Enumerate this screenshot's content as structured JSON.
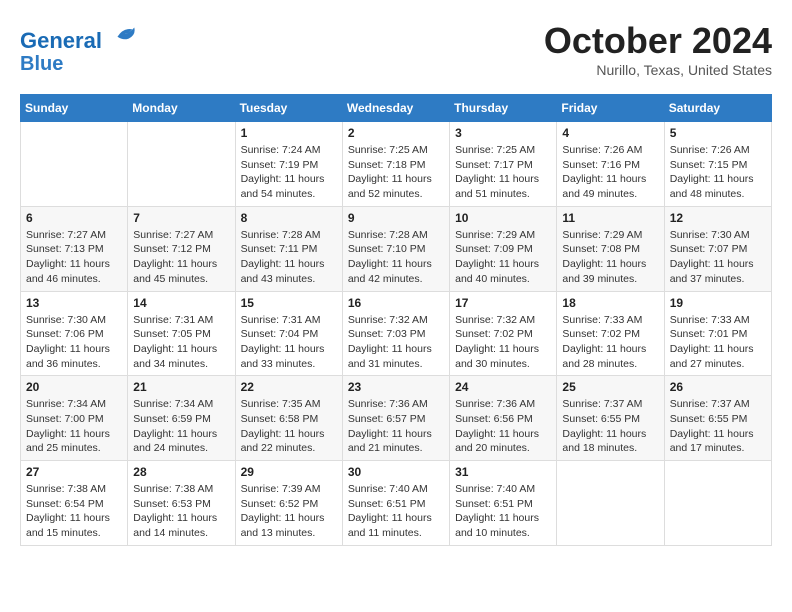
{
  "header": {
    "logo_line1": "General",
    "logo_line2": "Blue",
    "month": "October 2024",
    "location": "Nurillo, Texas, United States"
  },
  "weekdays": [
    "Sunday",
    "Monday",
    "Tuesday",
    "Wednesday",
    "Thursday",
    "Friday",
    "Saturday"
  ],
  "weeks": [
    [
      {
        "day": "",
        "sunrise": "",
        "sunset": "",
        "daylight": ""
      },
      {
        "day": "",
        "sunrise": "",
        "sunset": "",
        "daylight": ""
      },
      {
        "day": "1",
        "sunrise": "Sunrise: 7:24 AM",
        "sunset": "Sunset: 7:19 PM",
        "daylight": "Daylight: 11 hours and 54 minutes."
      },
      {
        "day": "2",
        "sunrise": "Sunrise: 7:25 AM",
        "sunset": "Sunset: 7:18 PM",
        "daylight": "Daylight: 11 hours and 52 minutes."
      },
      {
        "day": "3",
        "sunrise": "Sunrise: 7:25 AM",
        "sunset": "Sunset: 7:17 PM",
        "daylight": "Daylight: 11 hours and 51 minutes."
      },
      {
        "day": "4",
        "sunrise": "Sunrise: 7:26 AM",
        "sunset": "Sunset: 7:16 PM",
        "daylight": "Daylight: 11 hours and 49 minutes."
      },
      {
        "day": "5",
        "sunrise": "Sunrise: 7:26 AM",
        "sunset": "Sunset: 7:15 PM",
        "daylight": "Daylight: 11 hours and 48 minutes."
      }
    ],
    [
      {
        "day": "6",
        "sunrise": "Sunrise: 7:27 AM",
        "sunset": "Sunset: 7:13 PM",
        "daylight": "Daylight: 11 hours and 46 minutes."
      },
      {
        "day": "7",
        "sunrise": "Sunrise: 7:27 AM",
        "sunset": "Sunset: 7:12 PM",
        "daylight": "Daylight: 11 hours and 45 minutes."
      },
      {
        "day": "8",
        "sunrise": "Sunrise: 7:28 AM",
        "sunset": "Sunset: 7:11 PM",
        "daylight": "Daylight: 11 hours and 43 minutes."
      },
      {
        "day": "9",
        "sunrise": "Sunrise: 7:28 AM",
        "sunset": "Sunset: 7:10 PM",
        "daylight": "Daylight: 11 hours and 42 minutes."
      },
      {
        "day": "10",
        "sunrise": "Sunrise: 7:29 AM",
        "sunset": "Sunset: 7:09 PM",
        "daylight": "Daylight: 11 hours and 40 minutes."
      },
      {
        "day": "11",
        "sunrise": "Sunrise: 7:29 AM",
        "sunset": "Sunset: 7:08 PM",
        "daylight": "Daylight: 11 hours and 39 minutes."
      },
      {
        "day": "12",
        "sunrise": "Sunrise: 7:30 AM",
        "sunset": "Sunset: 7:07 PM",
        "daylight": "Daylight: 11 hours and 37 minutes."
      }
    ],
    [
      {
        "day": "13",
        "sunrise": "Sunrise: 7:30 AM",
        "sunset": "Sunset: 7:06 PM",
        "daylight": "Daylight: 11 hours and 36 minutes."
      },
      {
        "day": "14",
        "sunrise": "Sunrise: 7:31 AM",
        "sunset": "Sunset: 7:05 PM",
        "daylight": "Daylight: 11 hours and 34 minutes."
      },
      {
        "day": "15",
        "sunrise": "Sunrise: 7:31 AM",
        "sunset": "Sunset: 7:04 PM",
        "daylight": "Daylight: 11 hours and 33 minutes."
      },
      {
        "day": "16",
        "sunrise": "Sunrise: 7:32 AM",
        "sunset": "Sunset: 7:03 PM",
        "daylight": "Daylight: 11 hours and 31 minutes."
      },
      {
        "day": "17",
        "sunrise": "Sunrise: 7:32 AM",
        "sunset": "Sunset: 7:02 PM",
        "daylight": "Daylight: 11 hours and 30 minutes."
      },
      {
        "day": "18",
        "sunrise": "Sunrise: 7:33 AM",
        "sunset": "Sunset: 7:02 PM",
        "daylight": "Daylight: 11 hours and 28 minutes."
      },
      {
        "day": "19",
        "sunrise": "Sunrise: 7:33 AM",
        "sunset": "Sunset: 7:01 PM",
        "daylight": "Daylight: 11 hours and 27 minutes."
      }
    ],
    [
      {
        "day": "20",
        "sunrise": "Sunrise: 7:34 AM",
        "sunset": "Sunset: 7:00 PM",
        "daylight": "Daylight: 11 hours and 25 minutes."
      },
      {
        "day": "21",
        "sunrise": "Sunrise: 7:34 AM",
        "sunset": "Sunset: 6:59 PM",
        "daylight": "Daylight: 11 hours and 24 minutes."
      },
      {
        "day": "22",
        "sunrise": "Sunrise: 7:35 AM",
        "sunset": "Sunset: 6:58 PM",
        "daylight": "Daylight: 11 hours and 22 minutes."
      },
      {
        "day": "23",
        "sunrise": "Sunrise: 7:36 AM",
        "sunset": "Sunset: 6:57 PM",
        "daylight": "Daylight: 11 hours and 21 minutes."
      },
      {
        "day": "24",
        "sunrise": "Sunrise: 7:36 AM",
        "sunset": "Sunset: 6:56 PM",
        "daylight": "Daylight: 11 hours and 20 minutes."
      },
      {
        "day": "25",
        "sunrise": "Sunrise: 7:37 AM",
        "sunset": "Sunset: 6:55 PM",
        "daylight": "Daylight: 11 hours and 18 minutes."
      },
      {
        "day": "26",
        "sunrise": "Sunrise: 7:37 AM",
        "sunset": "Sunset: 6:55 PM",
        "daylight": "Daylight: 11 hours and 17 minutes."
      }
    ],
    [
      {
        "day": "27",
        "sunrise": "Sunrise: 7:38 AM",
        "sunset": "Sunset: 6:54 PM",
        "daylight": "Daylight: 11 hours and 15 minutes."
      },
      {
        "day": "28",
        "sunrise": "Sunrise: 7:38 AM",
        "sunset": "Sunset: 6:53 PM",
        "daylight": "Daylight: 11 hours and 14 minutes."
      },
      {
        "day": "29",
        "sunrise": "Sunrise: 7:39 AM",
        "sunset": "Sunset: 6:52 PM",
        "daylight": "Daylight: 11 hours and 13 minutes."
      },
      {
        "day": "30",
        "sunrise": "Sunrise: 7:40 AM",
        "sunset": "Sunset: 6:51 PM",
        "daylight": "Daylight: 11 hours and 11 minutes."
      },
      {
        "day": "31",
        "sunrise": "Sunrise: 7:40 AM",
        "sunset": "Sunset: 6:51 PM",
        "daylight": "Daylight: 11 hours and 10 minutes."
      },
      {
        "day": "",
        "sunrise": "",
        "sunset": "",
        "daylight": ""
      },
      {
        "day": "",
        "sunrise": "",
        "sunset": "",
        "daylight": ""
      }
    ]
  ]
}
